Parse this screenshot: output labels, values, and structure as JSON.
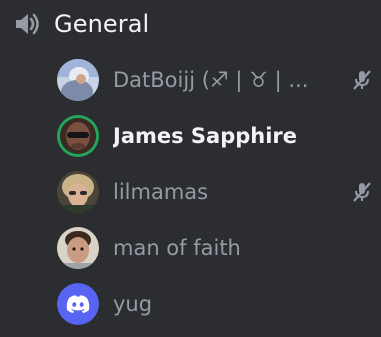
{
  "channel": {
    "name": "General",
    "icon": "speaker-icon"
  },
  "users": [
    {
      "name": "DatBoijj (♐ | ♉ | ...",
      "muted": true,
      "speaking": false,
      "avatar": "photo-avatar"
    },
    {
      "name": "James Sapphire",
      "muted": false,
      "speaking": true,
      "avatar": "photo-avatar"
    },
    {
      "name": "lilmamas",
      "muted": true,
      "speaking": false,
      "avatar": "photo-avatar"
    },
    {
      "name": "man of faith",
      "muted": false,
      "speaking": false,
      "avatar": "photo-avatar"
    },
    {
      "name": "yug",
      "muted": false,
      "speaking": false,
      "avatar": "discord-default-avatar"
    }
  ],
  "colors": {
    "background": "#2b2d31",
    "speaking_ring": "#23a55a",
    "name_active": "#f2f3f5",
    "name_inactive": "#949ba4",
    "discord_blurple": "#5865f2"
  }
}
